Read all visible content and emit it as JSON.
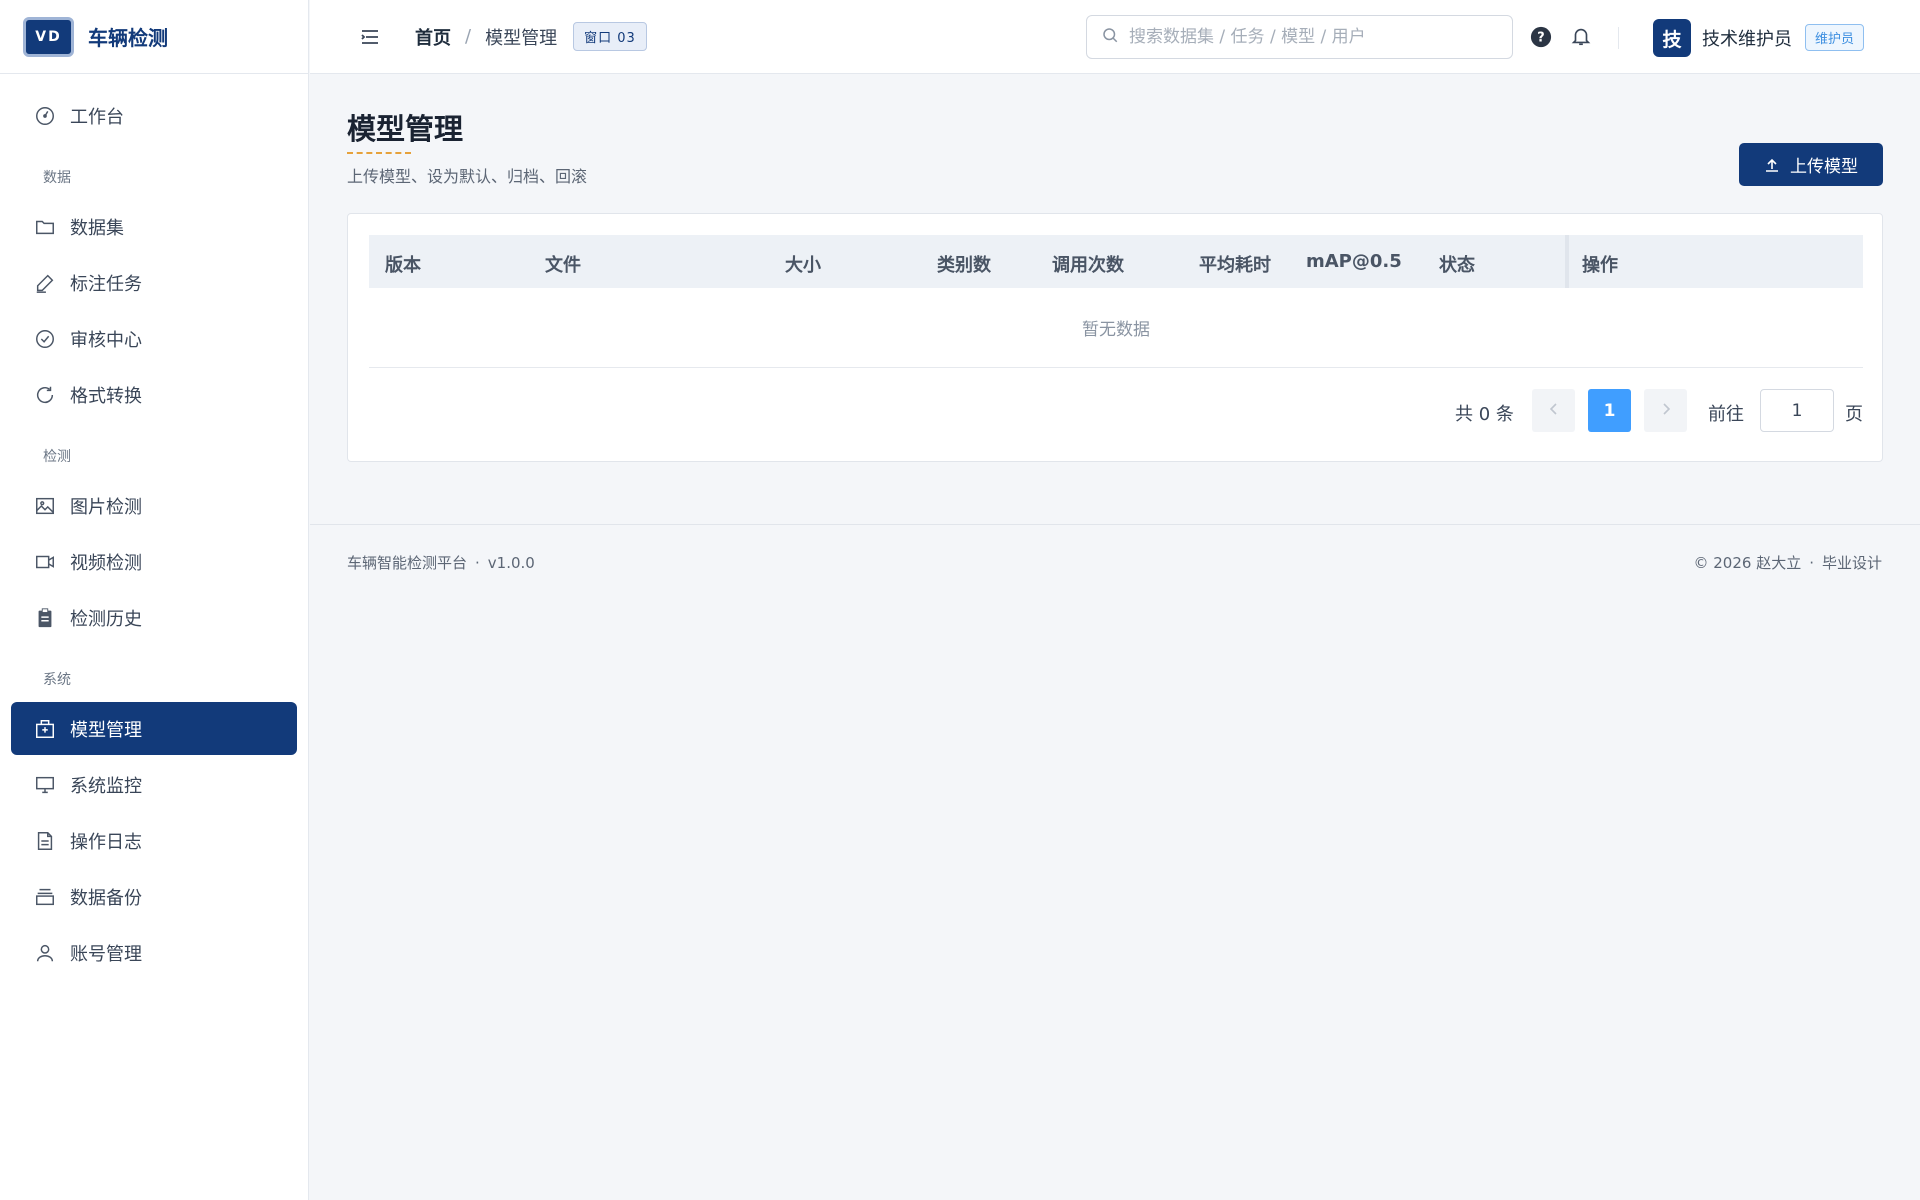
{
  "brand": {
    "logo_text": "VD",
    "name": "车辆检测"
  },
  "sidebar": {
    "items_top": [
      {
        "label": "工作台",
        "icon": "dashboard-icon"
      }
    ],
    "groups": [
      {
        "title": "数据",
        "items": [
          {
            "label": "数据集",
            "icon": "folder-icon"
          },
          {
            "label": "标注任务",
            "icon": "pen-icon"
          },
          {
            "label": "审核中心",
            "icon": "check-circle-icon"
          },
          {
            "label": "格式转换",
            "icon": "refresh-icon"
          }
        ]
      },
      {
        "title": "检测",
        "items": [
          {
            "label": "图片检测",
            "icon": "image-icon"
          },
          {
            "label": "视频检测",
            "icon": "video-camera-icon"
          },
          {
            "label": "检测历史",
            "icon": "clipboard-icon"
          }
        ]
      },
      {
        "title": "系统",
        "items": [
          {
            "label": "模型管理",
            "icon": "box-icon",
            "active": true
          },
          {
            "label": "系统监控",
            "icon": "monitor-icon"
          },
          {
            "label": "操作日志",
            "icon": "document-icon"
          },
          {
            "label": "数据备份",
            "icon": "archive-icon"
          },
          {
            "label": "账号管理",
            "icon": "user-icon"
          }
        ]
      }
    ]
  },
  "header": {
    "breadcrumb_home": "首页",
    "breadcrumb_sep": "/",
    "breadcrumb_current": "模型管理",
    "window_tag": "窗口 03",
    "search_placeholder": "搜索数据集 / 任务 / 模型 / 用户",
    "avatar_text": "技",
    "user_name": "技术维护员",
    "role_badge": "维护员"
  },
  "main": {
    "title": "模型管理",
    "subtitle": "上传模型、设为默认、归档、回滚",
    "upload_button": "上传模型",
    "table": {
      "columns": [
        "版本",
        "文件",
        "大小",
        "类别数",
        "调用次数",
        "平均耗时",
        "mAP@0.5",
        "状态",
        "操作"
      ],
      "empty_text": "暂无数据"
    },
    "pagination": {
      "total_text": "共 0 条",
      "current_page": "1",
      "goto_label": "前往",
      "goto_value": "1",
      "page_suffix": "页"
    }
  },
  "footer": {
    "platform": "车辆智能检测平台",
    "version": "v1.0.0",
    "copyright": "© 2026 赵大立",
    "design": "毕业设计"
  },
  "colors": {
    "brand": "#123a7a",
    "accent": "#409eff",
    "highlight": "#e6a23c"
  }
}
